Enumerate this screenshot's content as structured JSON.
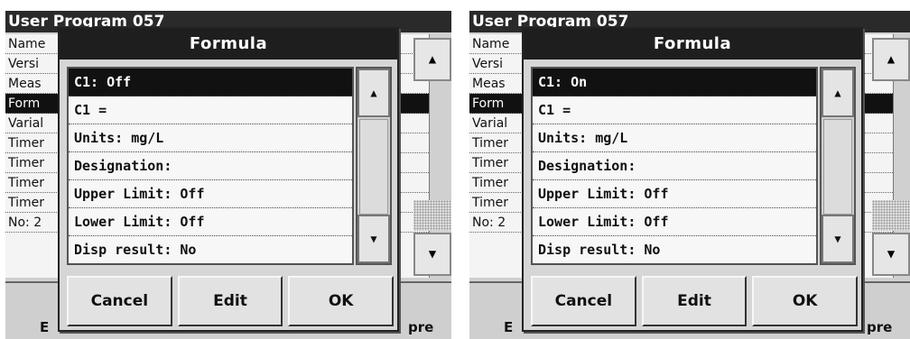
{
  "screens": [
    {
      "background_window": {
        "title": "User Program    057",
        "rows": [
          "Name",
          "Versi",
          "Meas",
          "Form",
          "Varial",
          "Timer",
          "Timer",
          "Timer",
          "Timer",
          "No: 2"
        ],
        "selected_row": 3,
        "bottom_left_label": "E",
        "bottom_right_label": "pre"
      },
      "dialog": {
        "title": "Formula",
        "rows": [
          "C1: Off",
          "C1 =",
          "Units: mg/L",
          "Designation:",
          "Upper Limit: Off",
          "Lower Limit: Off",
          "Disp result: No"
        ],
        "selected_row": 0,
        "buttons": {
          "cancel": "Cancel",
          "edit": "Edit",
          "ok": "OK"
        }
      }
    },
    {
      "background_window": {
        "title": "User Program    057",
        "rows": [
          "Name",
          "Versi",
          "Meas",
          "Form",
          "Varial",
          "Timer",
          "Timer",
          "Timer",
          "Timer",
          "No: 2"
        ],
        "selected_row": 3,
        "bottom_left_label": "E",
        "bottom_right_label": "pre"
      },
      "dialog": {
        "title": "Formula",
        "rows": [
          "C1: On",
          "C1 =",
          "Units: mg/L",
          "Designation:",
          "Upper Limit: Off",
          "Lower Limit: Off",
          "Disp result: No"
        ],
        "selected_row": 0,
        "buttons": {
          "cancel": "Cancel",
          "edit": "Edit",
          "ok": "OK"
        }
      }
    }
  ],
  "icons": {
    "scroll_up": "triangle-up-icon",
    "scroll_down": "triangle-down-icon"
  }
}
